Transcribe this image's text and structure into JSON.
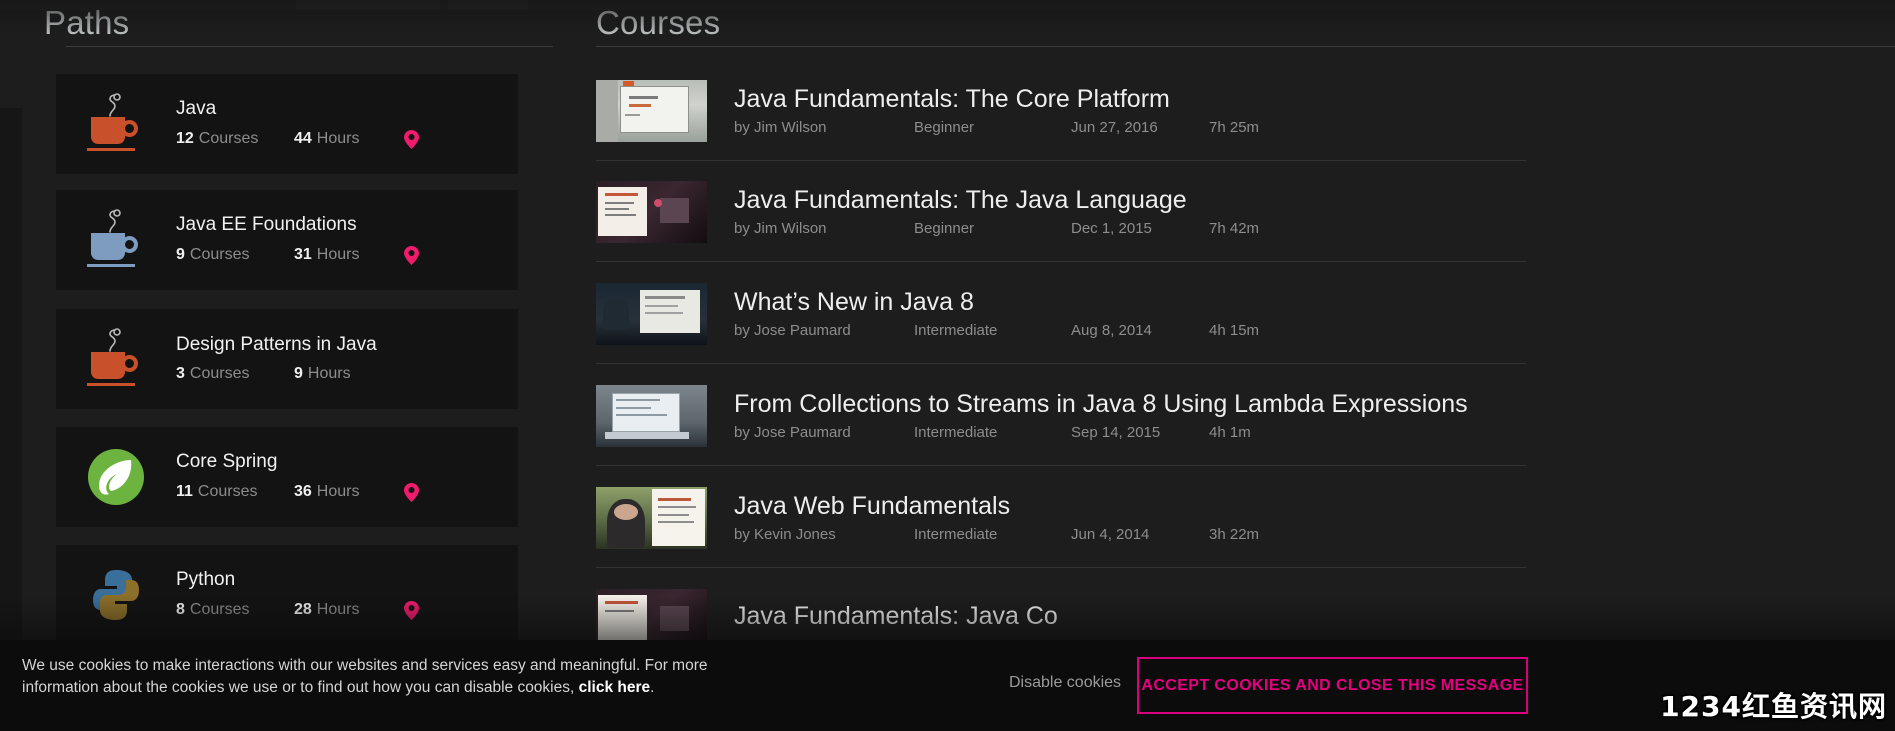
{
  "sections": {
    "paths_title": "Paths",
    "courses_title": "Courses"
  },
  "labels": {
    "courses_word": "Courses",
    "hours_word": "Hours",
    "by_prefix": "by "
  },
  "colors": {
    "accent_pink": "#e4007f",
    "pin_pink": "#ef1b6b",
    "cup_orange": "#c8502a",
    "cup_blue": "#7d9cc0",
    "spring_green": "#6db33f",
    "page_bg": "#1d1d1d",
    "card_bg": "#131313"
  },
  "paths": [
    {
      "name": "Java",
      "courses": "12",
      "hours": "44",
      "icon": "coffee-cup-icon",
      "icon_color": "#c8502a",
      "has_pin": true
    },
    {
      "name": "Java EE Foundations",
      "courses": "9",
      "hours": "31",
      "icon": "coffee-cup-icon",
      "icon_color": "#7d9cc0",
      "has_pin": true
    },
    {
      "name": "Design Patterns in Java",
      "courses": "3",
      "hours": "9",
      "icon": "coffee-cup-icon",
      "icon_color": "#c8502a",
      "has_pin": false
    },
    {
      "name": "Core Spring",
      "courses": "11",
      "hours": "36",
      "icon": "spring-leaf-icon",
      "icon_color": "#6db33f",
      "has_pin": true
    },
    {
      "name": "Python",
      "courses": "8",
      "hours": "28",
      "icon": "python-icon",
      "icon_color": "#3a6f9a",
      "has_pin": true
    }
  ],
  "courses": [
    {
      "title": "Java Fundamentals: The Core Platform",
      "author": "Jim Wilson",
      "level": "Beginner",
      "date": "Jun 27, 2016",
      "duration": "7h 25m",
      "thumb": "whiteboard-presentation-thumbnail"
    },
    {
      "title": "Java Fundamentals: The Java Language",
      "author": "Jim Wilson",
      "level": "Beginner",
      "date": "Dec 1, 2015",
      "duration": "7h 42m",
      "thumb": "slide-and-monitor-thumbnail"
    },
    {
      "title": "What’s New in Java 8",
      "author": "Jose Paumard",
      "level": "Intermediate",
      "date": "Aug 8, 2014",
      "duration": "4h 15m",
      "thumb": "person-at-screen-thumbnail"
    },
    {
      "title": "From Collections to Streams in Java 8 Using Lambda Expressions",
      "author": "Jose Paumard",
      "level": "Intermediate",
      "date": "Sep 14, 2015",
      "duration": "4h 1m",
      "thumb": "laptop-code-thumbnail"
    },
    {
      "title": "Java Web Fundamentals",
      "author": "Kevin Jones",
      "level": "Intermediate",
      "date": "Jun 4, 2014",
      "duration": "3h 22m",
      "thumb": "person-with-document-thumbnail"
    },
    {
      "title": "Java Fundamentals: Java Co",
      "author": "",
      "level": "",
      "date": "",
      "duration": "",
      "thumb": "partial-thumbnail"
    }
  ],
  "cookie_banner": {
    "line1": "We use cookies to make interactions with our websites and services easy and meaningful. For more",
    "line2_pre": "information about the cookies we use or to find out how you can disable cookies, ",
    "line2_link": "click here",
    "line2_post": ".",
    "disable_label": "Disable cookies",
    "accept_label": "ACCEPT COOKIES AND CLOSE THIS MESSAGE"
  },
  "watermark": "1234红鱼资讯网"
}
